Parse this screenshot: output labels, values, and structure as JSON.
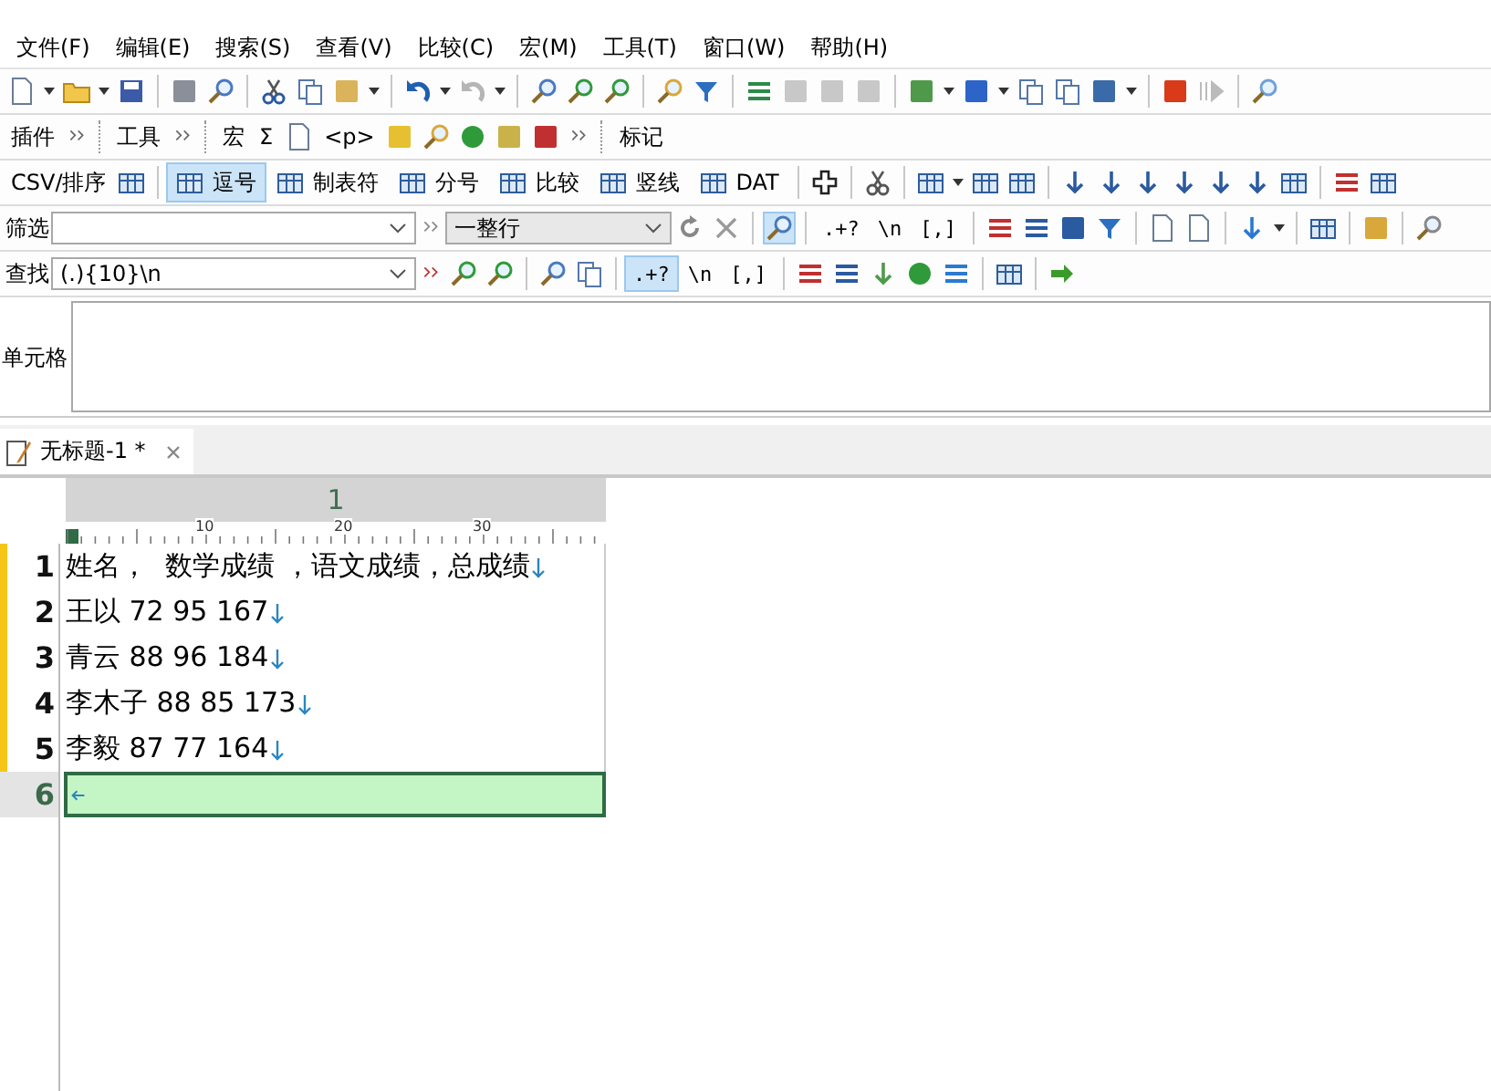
{
  "menu": [
    "文件(F)",
    "编辑(E)",
    "搜索(S)",
    "查看(V)",
    "比较(C)",
    "宏(M)",
    "工具(T)",
    "窗口(W)",
    "帮助(H)"
  ],
  "toolbar_2": {
    "groups": [
      "插件",
      "工具"
    ],
    "macro_label": "宏",
    "sigma": "Σ",
    "tag": "<p>",
    "marks": "标记"
  },
  "csv_bar": {
    "label": "CSV/排序",
    "separators": [
      {
        "label": "逗号",
        "selected": true
      },
      {
        "label": "制表符",
        "selected": false
      },
      {
        "label": "分号",
        "selected": false
      },
      {
        "label": "比较",
        "selected": false
      },
      {
        "label": "竖线",
        "selected": false
      },
      {
        "label": "DAT",
        "selected": false
      }
    ]
  },
  "filter_bar": {
    "label": "筛选",
    "scope": "一整行",
    "options": [
      {
        "label": ".+?",
        "selected": false
      },
      {
        "label": "\\n",
        "selected": false
      },
      {
        "label": "[,]",
        "selected": false
      }
    ]
  },
  "find_bar": {
    "label": "查找",
    "value": "(.){10}\\n",
    "options": [
      {
        "label": ".+?",
        "selected": true
      },
      {
        "label": "\\n",
        "selected": false
      },
      {
        "label": "[,]",
        "selected": false
      }
    ]
  },
  "cell_bar": {
    "label": "单元格"
  },
  "tabs": [
    {
      "title": "无标题-1 *",
      "selected": true
    }
  ],
  "editor": {
    "column_header": "1",
    "ruler": [
      "10",
      "20",
      "30"
    ],
    "lines": [
      {
        "number": "1",
        "text": "姓名，  数学成绩 ，语文成绩，总成绩",
        "kind": "newline",
        "modified": true,
        "current": false
      },
      {
        "number": "2",
        "text": "王以 72 95 167",
        "kind": "newline",
        "modified": true,
        "current": false
      },
      {
        "number": "3",
        "text": "青云 88 96 184",
        "kind": "newline",
        "modified": true,
        "current": false
      },
      {
        "number": "4",
        "text": "李木子 88 85 173",
        "kind": "newline",
        "modified": true,
        "current": false
      },
      {
        "number": "5",
        "text": "李毅 87 77 164",
        "kind": "newline",
        "modified": true,
        "current": false
      },
      {
        "number": "6",
        "kind": "eof",
        "modified": false,
        "current": true
      }
    ]
  }
}
